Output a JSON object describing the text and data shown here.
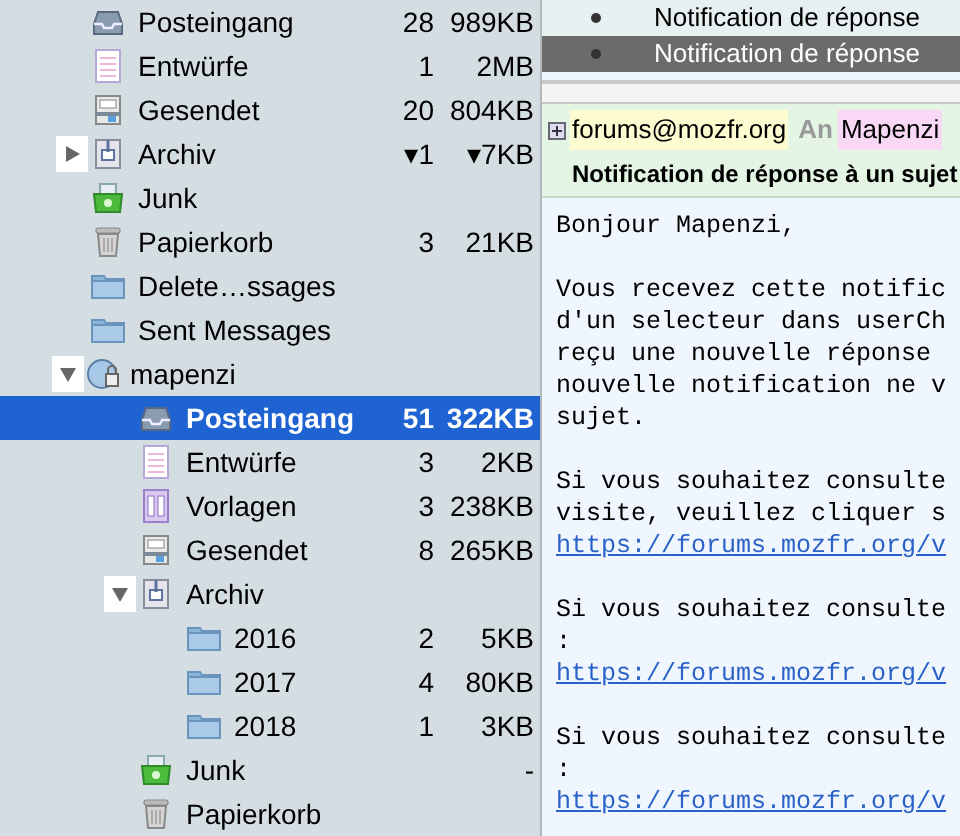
{
  "folder_tree": {
    "folders": [
      {
        "name": "Posteingang",
        "kind": "inbox",
        "unread": "28",
        "size": "989KB",
        "selected": false
      },
      {
        "name": "Entwürfe",
        "kind": "drafts",
        "unread": "1",
        "size": "2MB",
        "selected": false
      },
      {
        "name": "Gesendet",
        "kind": "sent",
        "unread": "20",
        "size": "804KB",
        "selected": false
      },
      {
        "name": "Archiv",
        "kind": "archive",
        "unread": "▾1",
        "size": "▾7KB",
        "selected": false,
        "expanded": false
      },
      {
        "name": "Junk",
        "kind": "junk",
        "selected": false
      },
      {
        "name": "Papierkorb",
        "kind": "trash",
        "unread": "3",
        "size": "21KB",
        "selected": false
      },
      {
        "name": "Delete…ssages",
        "kind": "folder",
        "selected": false
      },
      {
        "name": "Sent Messages",
        "kind": "folder",
        "selected": false
      },
      {
        "name": "mapenzi",
        "kind": "account",
        "selected": false,
        "expanded": true,
        "children": [
          {
            "name": "Posteingang",
            "kind": "inbox",
            "unread": "51",
            "size": "322KB",
            "selected": true
          },
          {
            "name": "Entwürfe",
            "kind": "drafts",
            "unread": "3",
            "size": "2KB",
            "selected": false
          },
          {
            "name": "Vorlagen",
            "kind": "templates",
            "unread": "3",
            "size": "238KB",
            "selected": false
          },
          {
            "name": "Gesendet",
            "kind": "sent",
            "unread": "8",
            "size": "265KB",
            "selected": false
          },
          {
            "name": "Archiv",
            "kind": "archive",
            "selected": false,
            "expanded": true,
            "children": [
              {
                "name": "2016",
                "kind": "folder",
                "unread": "2",
                "size": "5KB",
                "selected": false
              },
              {
                "name": "2017",
                "kind": "folder",
                "unread": "4",
                "size": "80KB",
                "selected": false
              },
              {
                "name": "2018",
                "kind": "folder",
                "unread": "1",
                "size": "3KB",
                "selected": false
              }
            ]
          },
          {
            "name": "Junk",
            "kind": "junk",
            "size": "-",
            "selected": false
          },
          {
            "name": "Papierkorb",
            "kind": "trash",
            "selected": false
          }
        ]
      }
    ]
  },
  "message_list": [
    {
      "subject": "Notification de réponse",
      "selected": false
    },
    {
      "subject": "Notification de réponse",
      "selected": true
    }
  ],
  "message": {
    "from": "forums@mozfr.org",
    "to_label": "An",
    "to": "Mapenzi",
    "subject": "Notification de réponse à un sujet",
    "body": [
      [
        "Bonjour Mapenzi,"
      ],
      [
        "Vous recevez cette notific",
        "d'un selecteur dans userCh",
        "reçu une nouvelle réponse",
        "nouvelle notification ne v",
        "sujet."
      ],
      [
        "Si vous souhaitez consulte",
        "visite, veuillez cliquer s",
        {
          "link": "https://forums.mozfr.org/v"
        }
      ],
      [
        "Si vous souhaitez consulte",
        ":",
        {
          "link": "https://forums.mozfr.org/v"
        }
      ],
      [
        "Si vous souhaitez consulte",
        ":",
        {
          "link": "https://forums.mozfr.org/v"
        }
      ]
    ]
  }
}
